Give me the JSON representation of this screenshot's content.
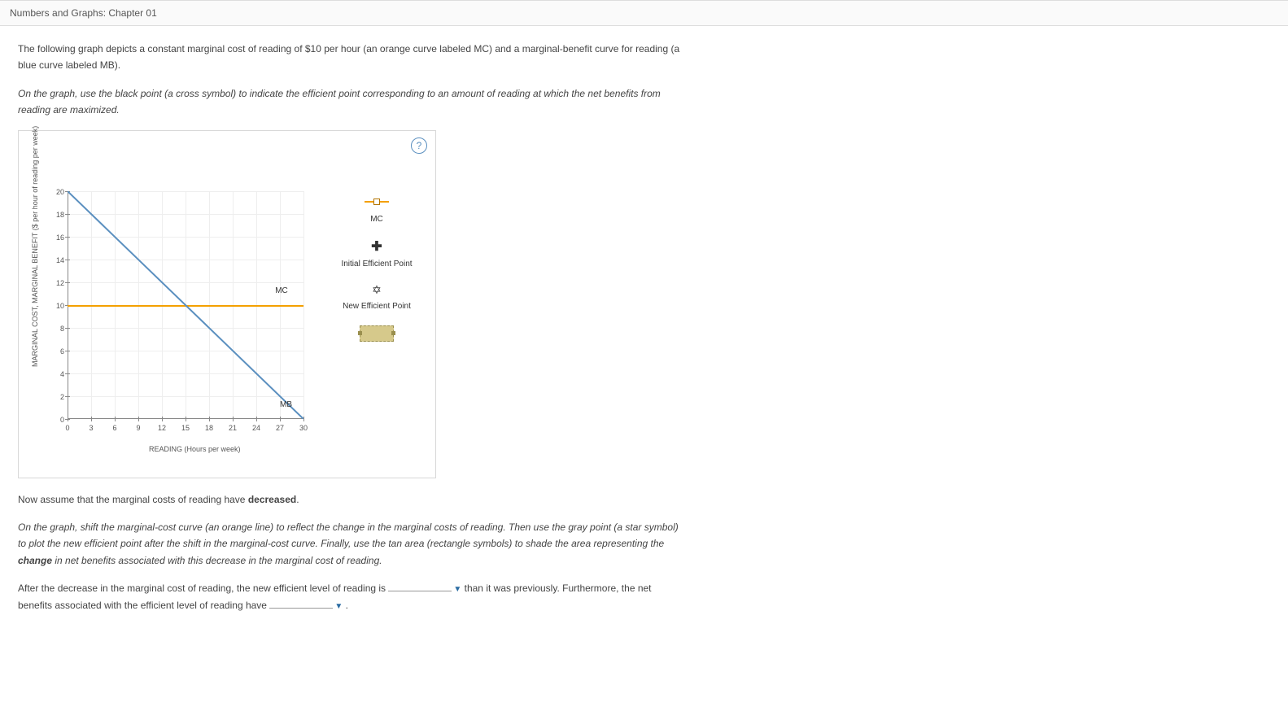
{
  "header": {
    "title": "Numbers and Graphs: Chapter 01"
  },
  "intro1": "The following graph depicts a constant marginal cost of reading of $10 per hour (an orange curve labeled MC) and a marginal-benefit curve for reading (a blue curve labeled MB).",
  "intro2": "On the graph, use the black point (a cross symbol) to indicate the efficient point corresponding to an amount of reading at which the net benefits from reading are maximized.",
  "help": "?",
  "chart_data": {
    "type": "line",
    "xlabel": "READING (Hours per week)",
    "ylabel": "MARGINAL COST, MARGINAL BENEFIT ($ per hour of reading per week)",
    "xlim": [
      0,
      30
    ],
    "ylim": [
      0,
      20
    ],
    "x_ticks": [
      0,
      3,
      6,
      9,
      12,
      15,
      18,
      21,
      24,
      27,
      30
    ],
    "y_ticks": [
      0,
      2,
      4,
      6,
      8,
      10,
      12,
      14,
      16,
      18,
      20
    ],
    "series": [
      {
        "name": "MC",
        "color": "#f4a000",
        "points": [
          [
            0,
            10
          ],
          [
            30,
            10
          ]
        ]
      },
      {
        "name": "MB",
        "color": "#5a8fbf",
        "points": [
          [
            0,
            20
          ],
          [
            30,
            0
          ]
        ]
      }
    ],
    "line_labels": {
      "MC": "MC",
      "MB": "MB"
    }
  },
  "palette": {
    "mc_label": "MC",
    "initial_label": "Initial Efficient Point",
    "new_label": "New Efficient Point"
  },
  "mid1_a": "Now assume that the marginal costs of reading have ",
  "mid1_b": "decreased",
  "mid1_c": ".",
  "mid2_a": "On the graph, shift the marginal-cost curve (an orange line) to reflect the change in the marginal costs of reading. Then use the gray point (a star symbol) to plot the new efficient point after the shift in the marginal-cost curve. Finally, use the tan area (rectangle symbols) to shade the area representing the ",
  "mid2_b": "change",
  "mid2_c": " in net benefits associated with this decrease in the marginal cost of reading.",
  "q_a": "After the decrease in the marginal cost of reading, the new efficient level of reading is ",
  "q_b": " than it was previously. Furthermore, the net benefits associated with the efficient level of reading have ",
  "q_c": " .",
  "blank": ""
}
